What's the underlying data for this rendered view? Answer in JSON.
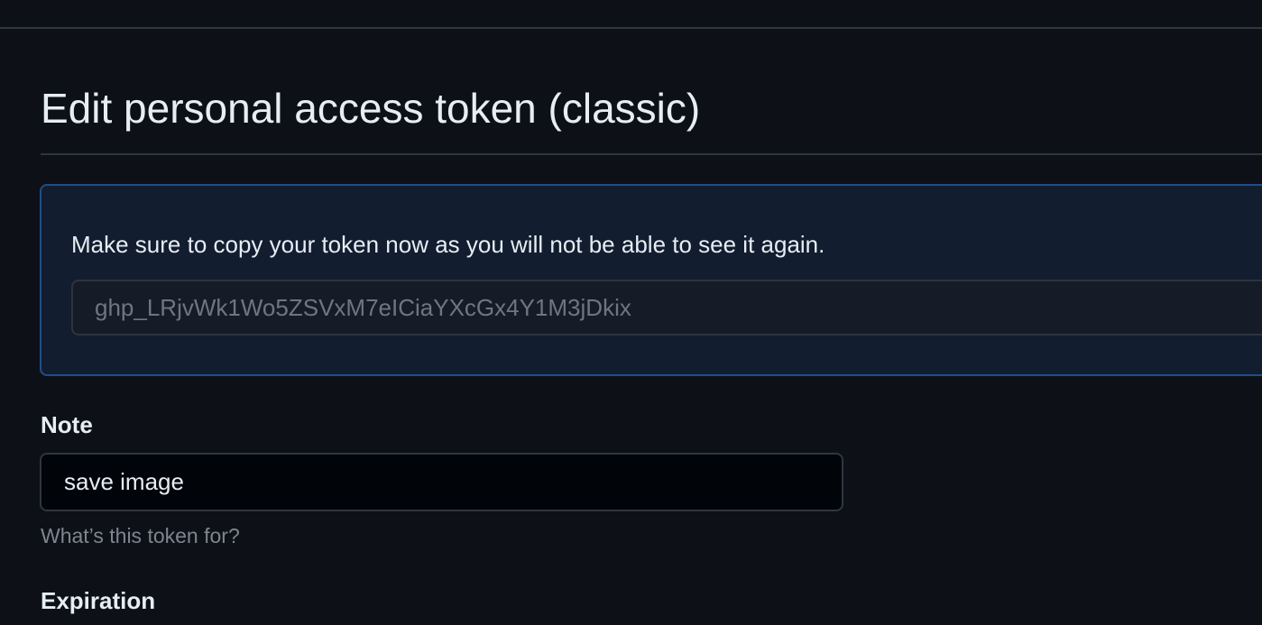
{
  "page": {
    "title": "Edit personal access token (classic)"
  },
  "flash": {
    "message": "Make sure to copy your token now as you will not be able to see it again.",
    "token_value": "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"
  },
  "note": {
    "label": "Note",
    "value": "save image",
    "hint": "What’s this token for?"
  },
  "expiration": {
    "label": "Expiration"
  },
  "colors": {
    "background": "#0d1117",
    "flash_background": "#121d2f",
    "flash_border": "#1f4d8a",
    "text_primary": "#e6edf3",
    "text_muted": "#7d8590"
  }
}
